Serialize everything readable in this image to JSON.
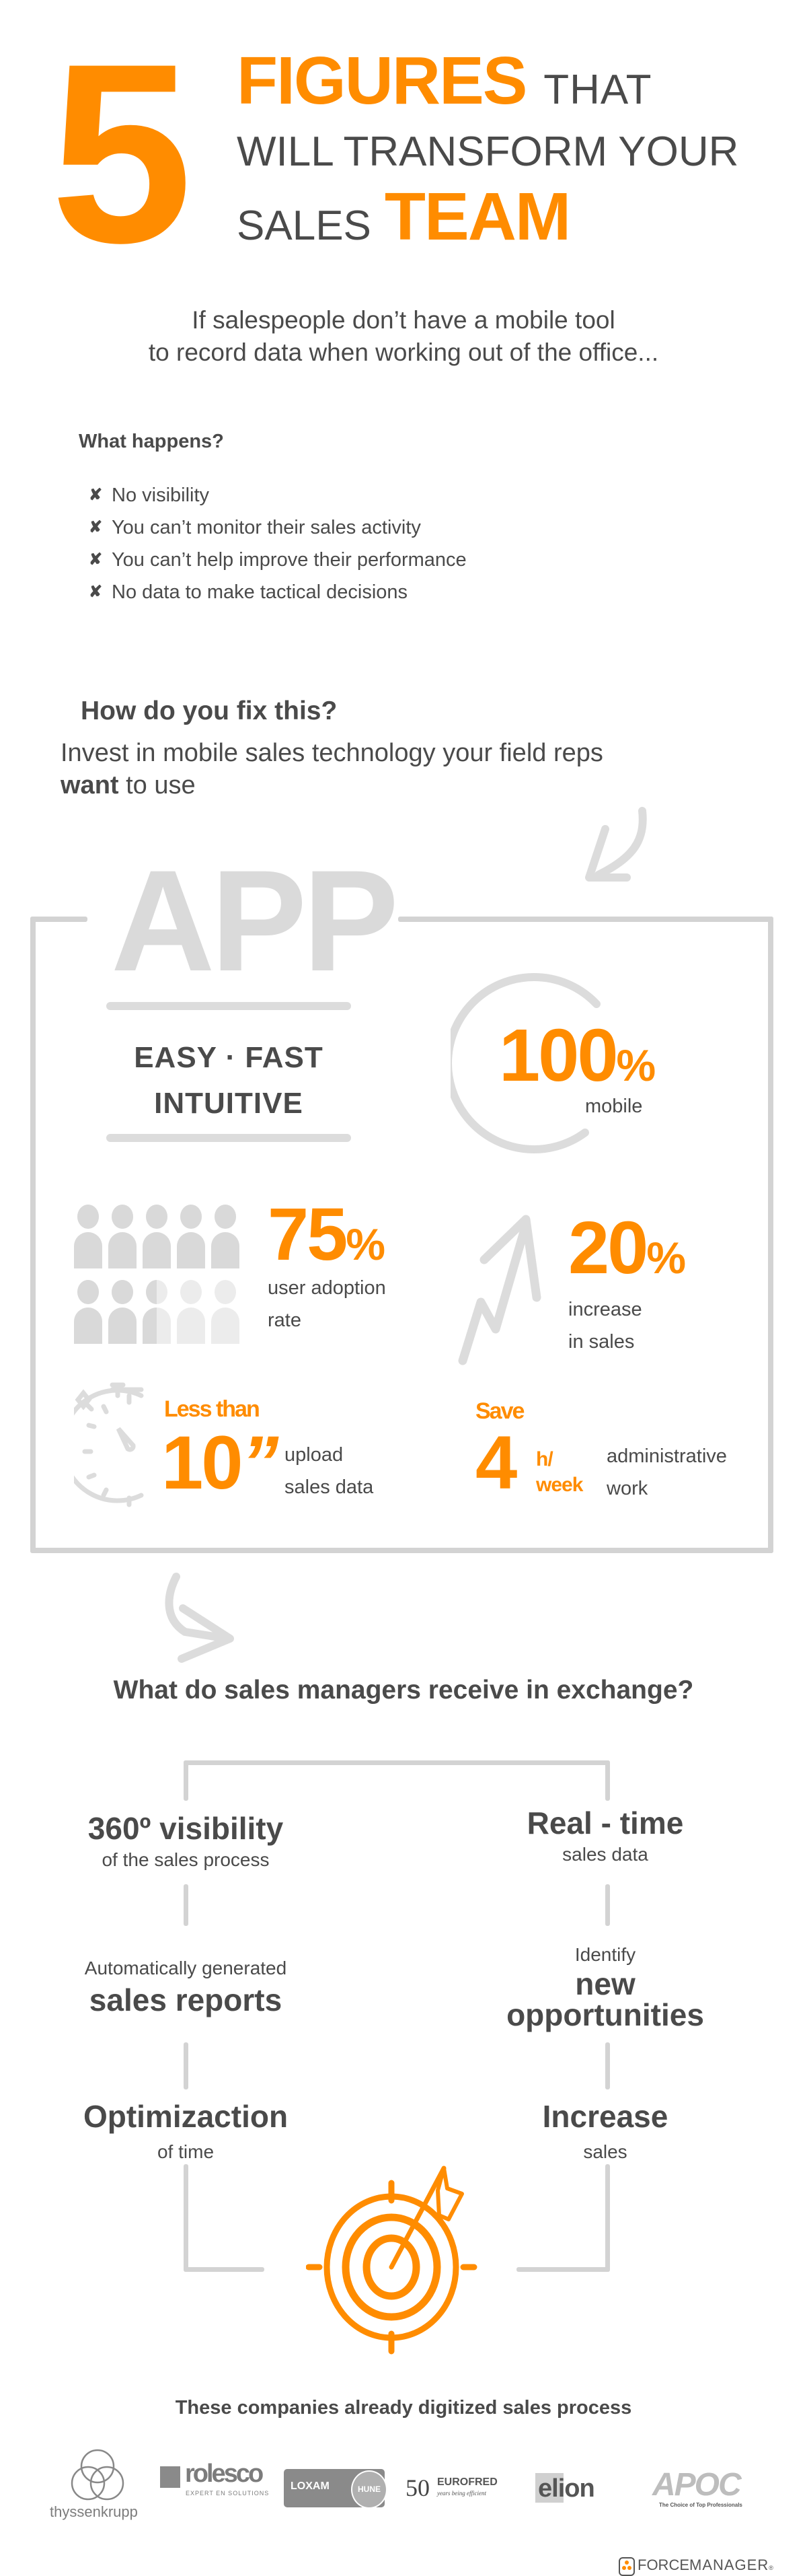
{
  "colors": {
    "accent": "#ff8c00",
    "text": "#4a4a4a",
    "light_gray": "#d3d3d3"
  },
  "header": {
    "number": "5",
    "line1_strong": "FIGURES",
    "line1_rest": "THAT",
    "line2": "WILL TRANSFORM YOUR",
    "line3_rest": "SALES",
    "line3_strong": "TEAM"
  },
  "intro": {
    "line1": "If salespeople don’t have a mobile tool",
    "line2": "to record data when working out of the office..."
  },
  "problems": {
    "title": "What happens?",
    "icon": "x-mark-icon",
    "items": [
      "No visibility",
      "You can’t monitor their sales activity",
      "You can’t help improve their performance",
      "No data to make tactical decisions"
    ]
  },
  "fix": {
    "question": "How do you fix this?",
    "answer_line1": "Invest in mobile sales technology your field reps",
    "answer_bold": "want",
    "answer_rest": "to use"
  },
  "app": {
    "title": "APP",
    "qualities_line1": "EASY · FAST",
    "qualities_line2": "INTUITIVE",
    "mobile": {
      "value": "100",
      "unit": "%",
      "label": "mobile"
    },
    "adoption": {
      "value": "75",
      "unit": "%",
      "label_line1": "user adoption",
      "label_line2": "rate",
      "filled_people": 7.5,
      "total_people": 10
    },
    "sales": {
      "value": "20",
      "unit": "%",
      "label_line1": "increase",
      "label_line2": "in sales"
    },
    "upload": {
      "prefix": "Less than",
      "value": "10",
      "unit": "”",
      "label_line1": "upload",
      "label_line2": "sales data"
    },
    "save": {
      "prefix": "Save",
      "value": "4",
      "unit_line1": "h/",
      "unit_line2": "week",
      "label_line1": "administrative",
      "label_line2": "work"
    }
  },
  "managers": {
    "question": "What do sales managers receive in exchange?",
    "benefits": [
      {
        "bold": "360º visibility",
        "sub": "of the sales process"
      },
      {
        "bold": "Real - time",
        "sub": "sales data"
      },
      {
        "pre": "Automatically generated",
        "bold": "sales reports"
      },
      {
        "pre": "Identify",
        "bold_line1": "new",
        "bold_line2": "opportunities"
      },
      {
        "bold": "Optimizaction",
        "sub": "of time"
      },
      {
        "bold": "Increase",
        "sub": "sales"
      }
    ]
  },
  "companies": {
    "title": "These companies already digitized sales process",
    "logos": [
      {
        "name": "thyssenkrupp"
      },
      {
        "name": "rolesco",
        "tagline": "EXPERT EN SOLUTIONS"
      },
      {
        "name": "LOXAM",
        "badge": "HUNE"
      },
      {
        "number": "50",
        "name": "EUROFRED",
        "tagline": "years being efficient"
      },
      {
        "name": "elion"
      },
      {
        "name": "APOC",
        "tagline": "The Choice of Top Professionals"
      }
    ]
  },
  "footer": {
    "brand_bold": "FORCE",
    "brand_light": "MANAGER",
    "registered": "®"
  }
}
